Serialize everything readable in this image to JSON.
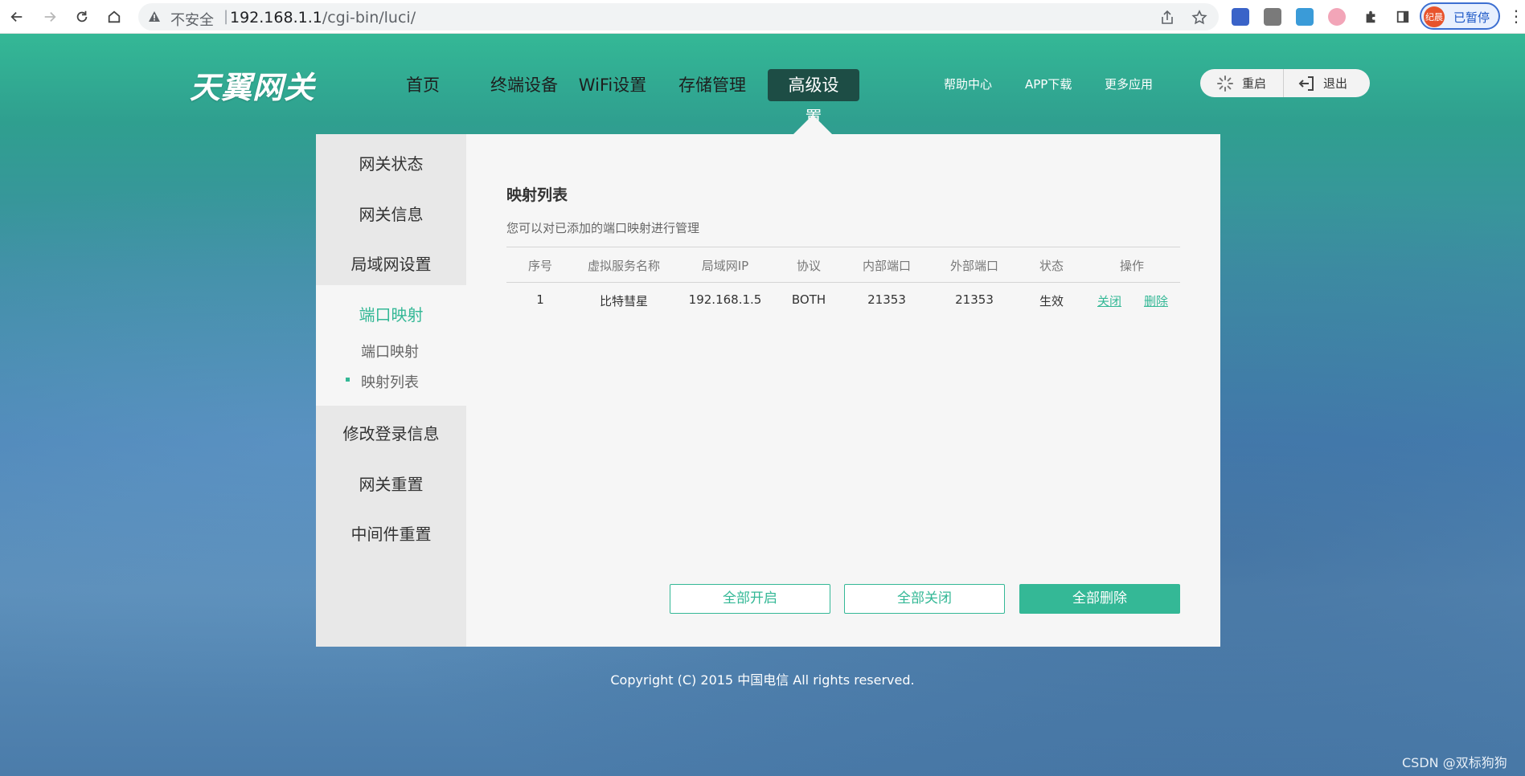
{
  "browser": {
    "insecure_label": "不安全",
    "separator": "|",
    "url_host": "192.168.1.1",
    "url_path": "/cgi-bin/luci/",
    "profile_avatar_text": "纪晨",
    "profile_label": "已暂停"
  },
  "header": {
    "logo_text": "天翼网关",
    "nav": [
      "首页",
      "终端设备",
      "WiFi设置",
      "存储管理",
      "高级设置"
    ],
    "active_nav_index": 4,
    "links": [
      "帮助中心",
      "APP下载",
      "更多应用"
    ],
    "restart_label": "重启",
    "logout_label": "退出"
  },
  "sidebar": {
    "items": [
      "网关状态",
      "网关信息",
      "局域网设置",
      "端口映射",
      "修改登录信息",
      "网关重置",
      "中间件重置"
    ],
    "active_item": "端口映射",
    "sub_items": [
      "端口映射",
      "映射列表"
    ],
    "active_sub": "映射列表"
  },
  "main": {
    "title": "映射列表",
    "description": "您可以对已添加的端口映射进行管理",
    "table": {
      "headers": [
        "序号",
        "虚拟服务名称",
        "局域网IP",
        "协议",
        "内部端口",
        "外部端口",
        "状态",
        "操作"
      ],
      "rows": [
        [
          "1",
          "比特彗星",
          "192.168.1.5",
          "BOTH",
          "21353",
          "21353",
          "生效",
          "关闭",
          "删除"
        ]
      ]
    },
    "buttons": {
      "enable_all": "全部开启",
      "disable_all": "全部关闭",
      "delete_all": "全部删除"
    }
  },
  "footer": {
    "copyright": "Copyright (C) 2015 中国电信 All rights reserved."
  },
  "watermark": "CSDN @双标狗狗",
  "colors": {
    "accent": "#34b896",
    "nav_active_bg": "#1d4d45"
  }
}
